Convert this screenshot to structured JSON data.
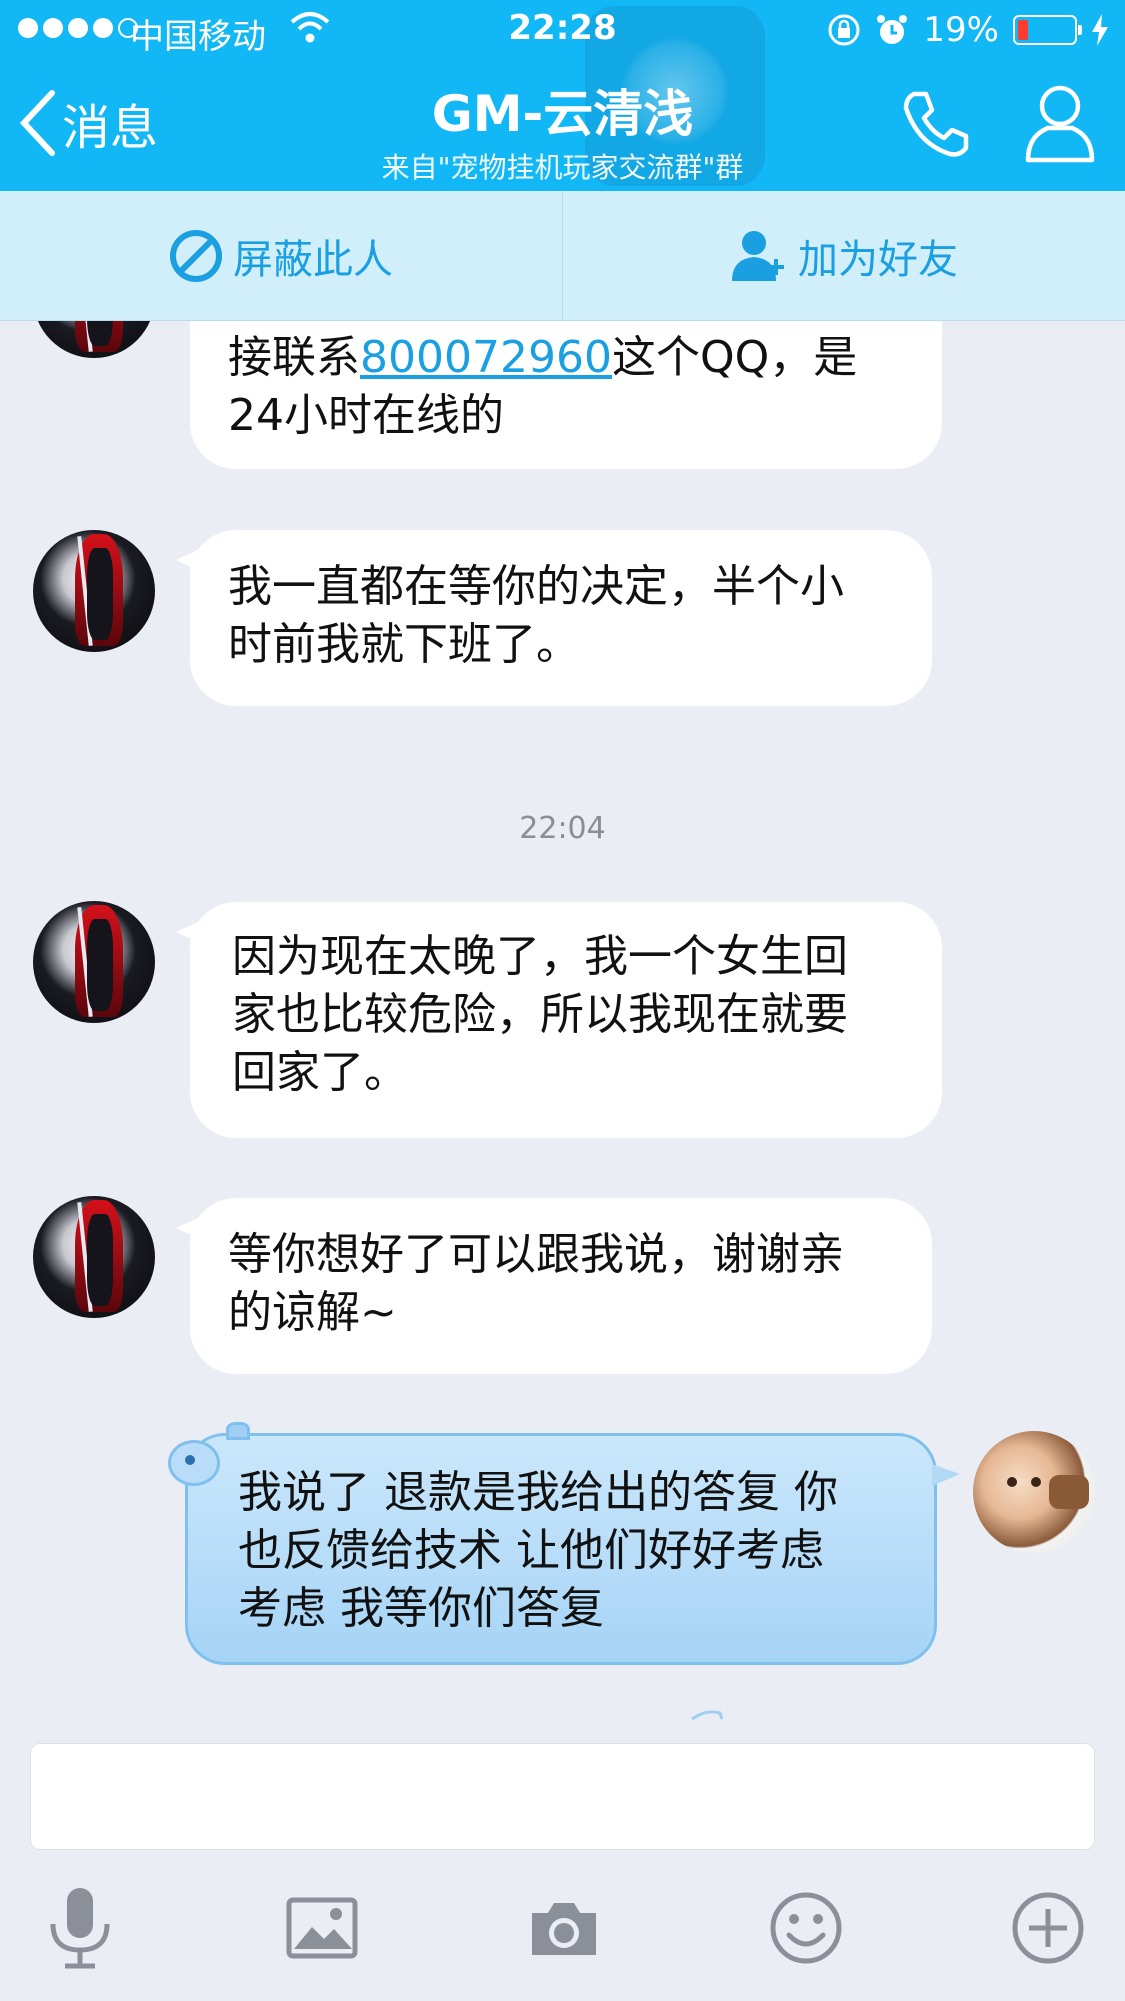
{
  "status_bar": {
    "carrier": "中国移动",
    "time": "22:28",
    "battery": "19%",
    "battery_level": 0.19
  },
  "navbar": {
    "back_label": "消息",
    "title": "GM-云清浅",
    "subtitle": "来自\"宠物挂机玩家交流群\"群"
  },
  "actions": {
    "block": "屏蔽此人",
    "add_friend": "加为好友"
  },
  "messages": [
    {
      "from": "other",
      "text_before": "接联系",
      "link": "800072960",
      "text_after_line1": "这个QQ，是",
      "line2": "24小时在线的"
    },
    {
      "from": "other",
      "lines": [
        "我一直都在等你的决定，半个小",
        "时前我就下班了。"
      ]
    },
    {
      "from": "other",
      "lines": [
        "因为现在太晚了，我一个女生回",
        "家也比较危险，所以我现在就要",
        "回家了。"
      ]
    },
    {
      "from": "other",
      "lines": [
        "等你想好了可以跟我说，谢谢亲",
        "的谅解~"
      ]
    },
    {
      "from": "me",
      "lines": [
        "我说了 退款是我给出的答复 你",
        "也反馈给技术 让他们好好考虑",
        "考虑 我等你们答复"
      ]
    }
  ],
  "timestamp": "22:04",
  "input": {
    "value": "",
    "placeholder": ""
  },
  "toolbar": [
    "microphone-icon",
    "image-icon",
    "camera-icon",
    "emoji-icon",
    "plus-icon"
  ],
  "colors": {
    "header": "#12b7f5",
    "action_bar": "#d1eefb",
    "accent": "#1a9fe0",
    "background": "#ebedf5"
  }
}
